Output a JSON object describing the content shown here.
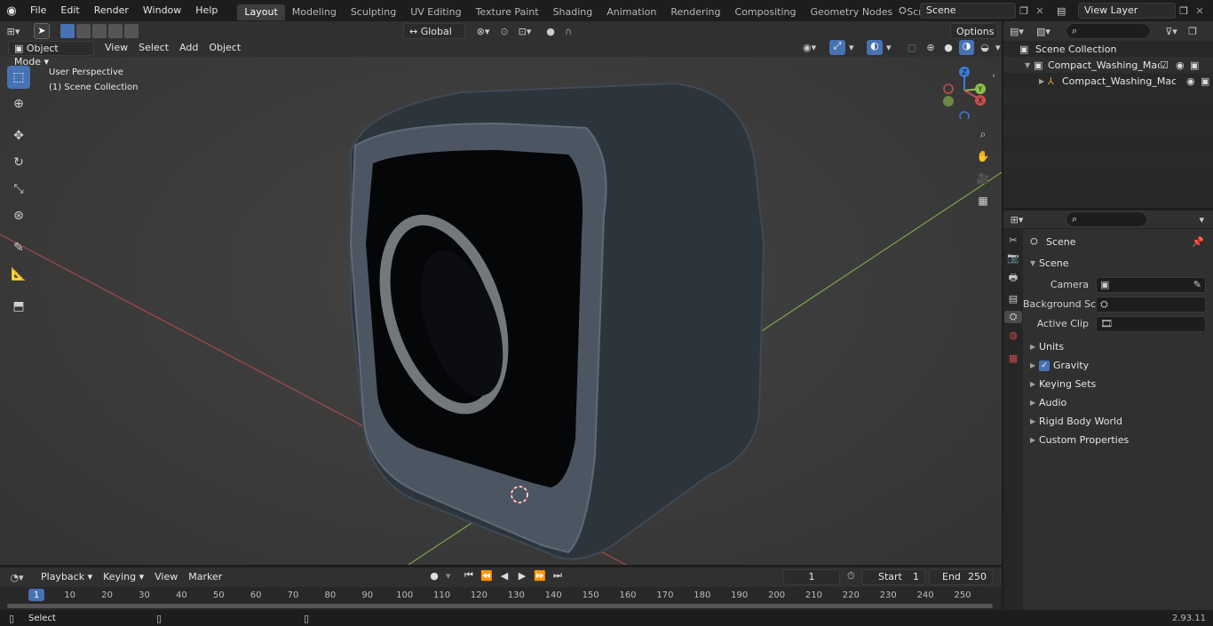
{
  "menu": [
    "File",
    "Edit",
    "Render",
    "Window",
    "Help"
  ],
  "workspaces": [
    "Layout",
    "Modeling",
    "Sculpting",
    "UV Editing",
    "Texture Paint",
    "Shading",
    "Animation",
    "Rendering",
    "Compositing",
    "Geometry Nodes",
    "Scripting"
  ],
  "active_workspace": "Layout",
  "scene_name": "Scene",
  "view_layer": "View Layer",
  "viewport": {
    "mode": "Object Mode",
    "menus": [
      "View",
      "Select",
      "Add",
      "Object"
    ],
    "transform_orientation": "Global",
    "options_label": "Options",
    "overlay_line1": "User Perspective",
    "overlay_line2": "(1) Scene Collection",
    "gizmo_axes": [
      "Z",
      "Y",
      "X"
    ]
  },
  "outliner": {
    "root": "Scene Collection",
    "items": [
      {
        "label": "Compact_Washing_Machine_"
      },
      {
        "label": "Compact_Washing_Mach"
      }
    ]
  },
  "properties": {
    "header": "Scene",
    "panel": "Scene",
    "rows": [
      {
        "label": "Camera"
      },
      {
        "label": "Background Scene"
      },
      {
        "label": "Active Clip"
      }
    ],
    "subpanels": [
      "Units",
      "Gravity",
      "Keying Sets",
      "Audio",
      "Rigid Body World",
      "Custom Properties"
    ]
  },
  "timeline": {
    "menus": [
      "Playback",
      "Keying",
      "View",
      "Marker"
    ],
    "current_frame": "1",
    "start_label": "Start",
    "start": "1",
    "end_label": "End",
    "end": "250",
    "ticks": [
      "1",
      "10",
      "20",
      "30",
      "40",
      "50",
      "60",
      "70",
      "80",
      "90",
      "100",
      "110",
      "120",
      "130",
      "140",
      "150",
      "160",
      "170",
      "180",
      "190",
      "200",
      "210",
      "220",
      "230",
      "240",
      "250"
    ]
  },
  "status": {
    "left": "Select",
    "version": "2.93.11"
  },
  "colors": {
    "accent": "#4772b3",
    "axis_x": "#c74d4d",
    "axis_y": "#8cc04d",
    "gizmo_z": "#3c7bd6"
  }
}
